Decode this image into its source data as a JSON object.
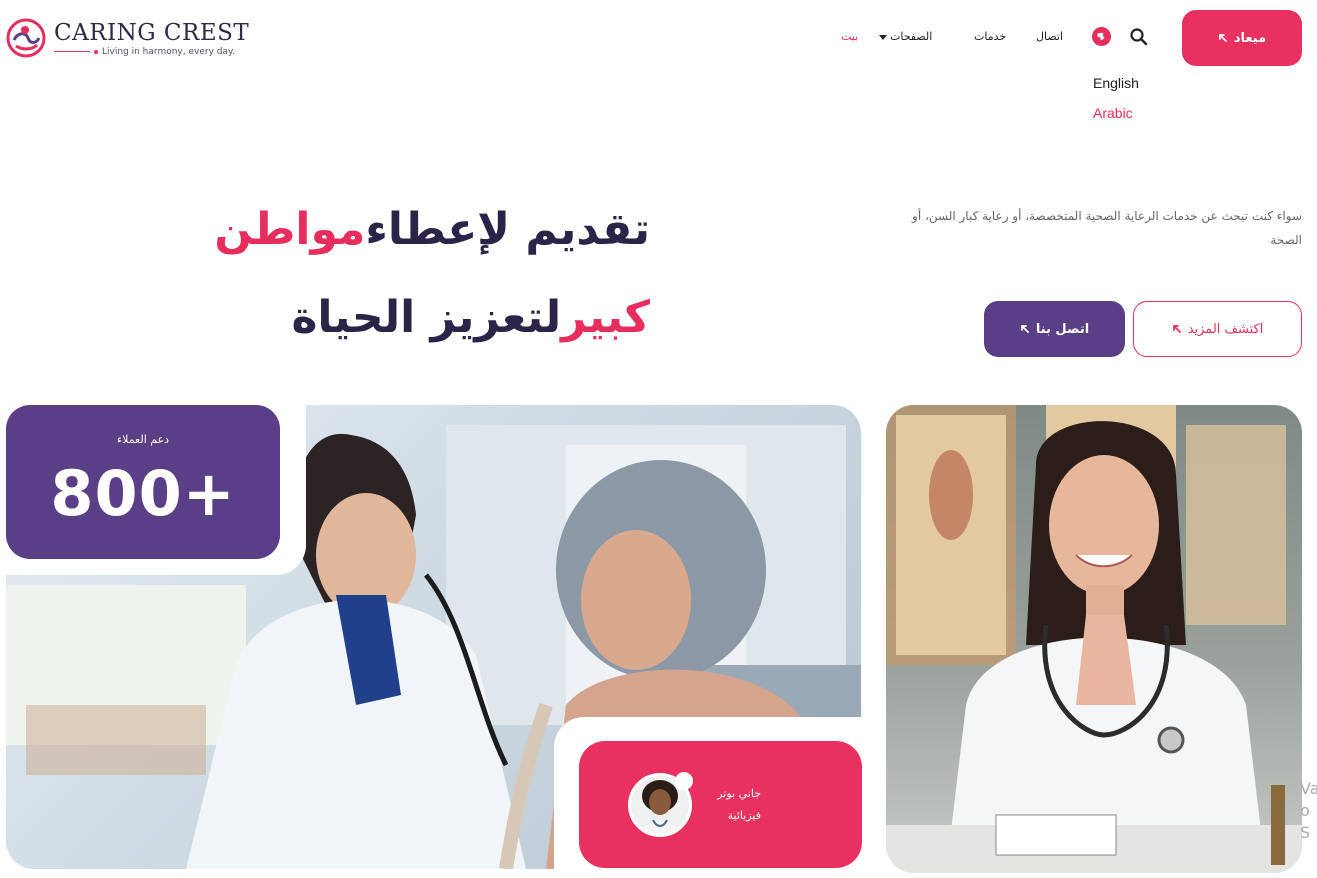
{
  "brand": {
    "name": "CARING CREST",
    "tagline": "Living in harmony, every day."
  },
  "nav": {
    "home": "بيت",
    "pages": "الصفحات",
    "services": "خدمات",
    "contact": "اتصال"
  },
  "language": {
    "options": [
      "English",
      "Arabic"
    ],
    "selected": "Arabic"
  },
  "header": {
    "appointment_button": "ميعاد"
  },
  "hero": {
    "title_part1": "تقديم لإعطاء",
    "title_highlight": "مواطن كبير",
    "title_part2": "لتعزيز الحياة",
    "description": "سواء كنت تبحث عن خدمات الرعاية الصحية المتخصصة، أو رعاية كبار السن، أو الصحة",
    "explore_button": "اكتشف المزيد",
    "contact_button": "اتصل بنا"
  },
  "stats": {
    "label": "دعم العملاء",
    "value": "800+"
  },
  "doctor_card": {
    "name": "جاني بوتر",
    "role": "فيزيائية"
  },
  "side_text": {
    "line1": "Va",
    "line2": "o S"
  },
  "colors": {
    "accent_pink": "#e8315f",
    "accent_purple": "#5a3e86",
    "heading_dark": "#2b2348"
  },
  "icons": [
    "arrow-up-left-icon",
    "globe-icon",
    "search-icon",
    "caret-down-icon"
  ]
}
